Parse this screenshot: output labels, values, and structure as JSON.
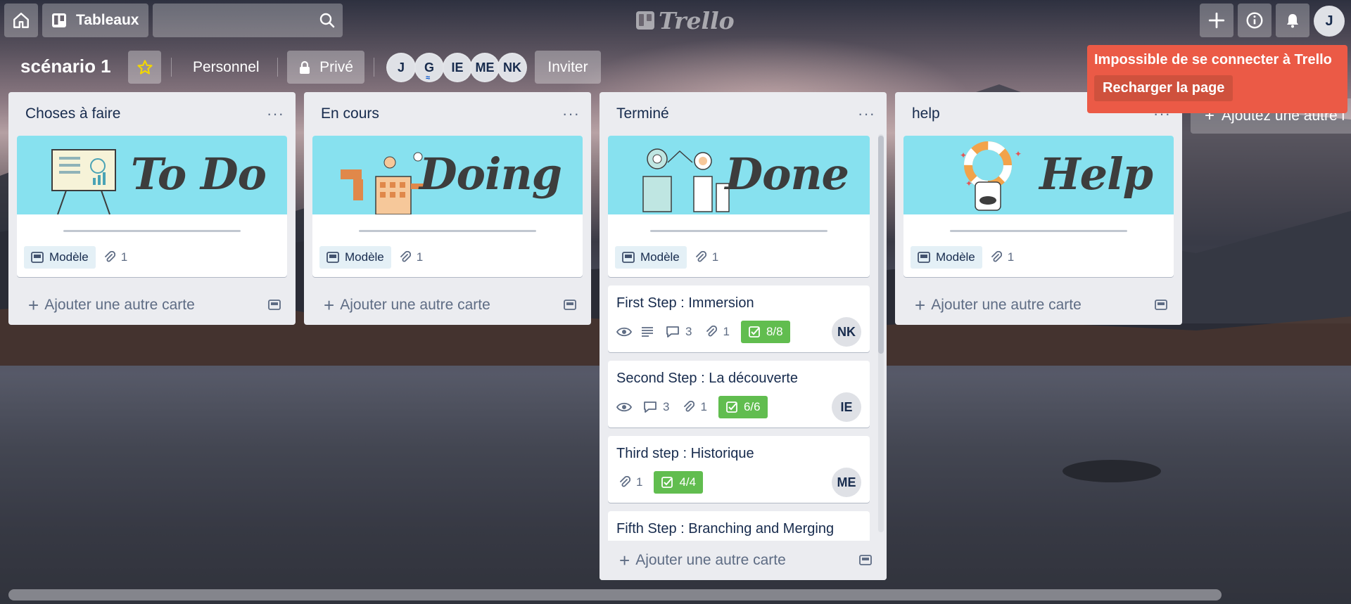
{
  "header": {
    "boards_label": "Tableaux",
    "logo_text": "Trello",
    "user_initial": "J"
  },
  "board": {
    "title": "scénario 1",
    "team_label": "Personnel",
    "visibility_label": "Privé",
    "members": [
      "J",
      "G",
      "IE",
      "ME",
      "NK"
    ],
    "invite_label": "Inviter"
  },
  "toast": {
    "message": "Impossible de se connecter à Trello",
    "reload_label": "Recharger la page"
  },
  "add_list_label": "Ajoutez une autre l",
  "lists": [
    {
      "title": "Choses à faire",
      "menu": "···",
      "template_card": {
        "cover_word": "To Do",
        "template_label": "Modèle",
        "attachments": "1"
      },
      "add_card_label": "Ajouter une autre carte"
    },
    {
      "title": "En cours",
      "menu": "···",
      "template_card": {
        "cover_word": "Doing",
        "template_label": "Modèle",
        "attachments": "1"
      },
      "add_card_label": "Ajouter une autre carte"
    },
    {
      "title": "Terminé",
      "menu": "···",
      "template_card": {
        "cover_word": "Done",
        "template_label": "Modèle",
        "attachments": "1"
      },
      "cards": [
        {
          "title": "First Step : Immersion",
          "comments": "3",
          "attachments": "1",
          "checklist": "8/8",
          "member": "NK"
        },
        {
          "title": "Second Step : La découverte",
          "comments": "3",
          "attachments": "1",
          "checklist": "6/6",
          "member": "IE"
        },
        {
          "title": "Third step : Historique",
          "attachments": "1",
          "checklist": "4/4",
          "member": "ME"
        },
        {
          "title": "Fifth Step : Branching and Merging"
        }
      ],
      "add_card_label": "Ajouter une autre carte"
    },
    {
      "title": "help",
      "menu": "···",
      "template_card": {
        "cover_word": "Help",
        "template_label": "Modèle",
        "attachments": "1"
      },
      "add_card_label": "Ajouter une autre carte"
    }
  ],
  "colors": {
    "list_bg": "#ebecf0",
    "cover_bg": "#87e1ef",
    "checklist_done": "#61bd4f",
    "toast_bg": "#eb5a46",
    "star": "#f2d600"
  }
}
